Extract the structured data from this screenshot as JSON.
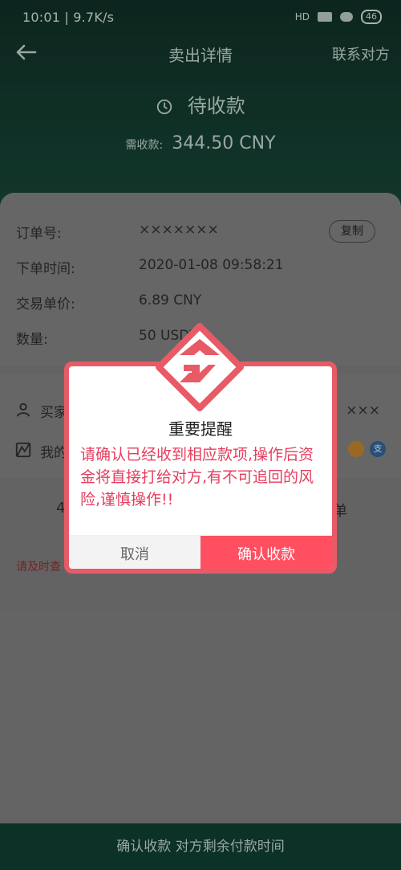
{
  "status_bar": {
    "left_text": "10:01 | 9.7K/s",
    "right_network": "HD",
    "battery": "46"
  },
  "nav": {
    "title": "卖出详情",
    "right_action": "联系对方"
  },
  "header": {
    "status": "待收款",
    "amount_label": "需收款:",
    "amount_value": "344.50 CNY"
  },
  "order": {
    "order_no_label": "订单号:",
    "order_no_value": "×××××××",
    "copy_label": "复制",
    "time_label": "下单时间:",
    "time_value": "2020-01-08 09:58:21",
    "price_label": "交易单价:",
    "price_value": "6.89 CNY",
    "qty_label": "数量:",
    "qty_value": "50 USDT"
  },
  "buyer": {
    "buyer_label": "买家",
    "buyer_value": "×××",
    "mine_label": "我的",
    "pay_icon_blue": "支"
  },
  "partials": {
    "left_frag": "4",
    "right_frag": "单",
    "notice": "请及时查"
  },
  "bottom_bar": {
    "text": "确认收款  对方剩余付款时间"
  },
  "modal": {
    "title": "重要提醒",
    "body": "请确认已经收到相应款项,操作后资金将直接打给对方,有不可追回的风险,谨慎操作!!",
    "cancel": "取消",
    "confirm": "确认收款"
  },
  "colors": {
    "header_bg": "#133a2e",
    "modal_border": "#e85b66",
    "modal_text": "#e53e5d",
    "confirm_bg": "#ff4f61"
  }
}
